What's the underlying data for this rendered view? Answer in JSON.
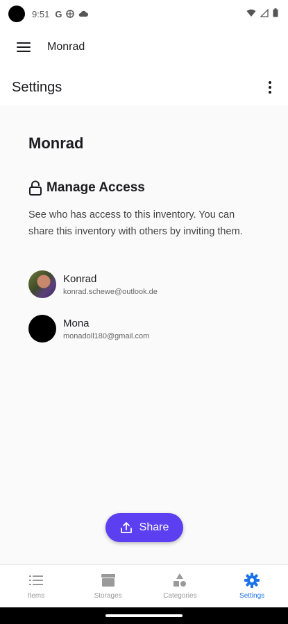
{
  "status_bar": {
    "time": "9:51",
    "icons": [
      "google-icon",
      "vpn-icon",
      "cloud-icon",
      "wifi-icon",
      "signal-icon",
      "battery-icon"
    ]
  },
  "app_bar": {
    "title": "Monrad"
  },
  "page_header": {
    "title": "Settings"
  },
  "inventory": {
    "name": "Monrad"
  },
  "manage_access": {
    "heading": "Manage Access",
    "description": "See who has access to this inventory. You can share this inventory with others by inviting them.",
    "members": [
      {
        "name": "Konrad",
        "email": "konrad.schewe@outlook.de",
        "avatar": "photo"
      },
      {
        "name": "Mona",
        "email": "monadoll180@gmail.com",
        "avatar": "black"
      }
    ]
  },
  "share_button": {
    "label": "Share"
  },
  "bottom_nav": {
    "items": [
      {
        "label": "Items",
        "icon": "list-icon"
      },
      {
        "label": "Storages",
        "icon": "storage-icon"
      },
      {
        "label": "Categories",
        "icon": "categories-icon"
      },
      {
        "label": "Settings",
        "icon": "gear-icon"
      }
    ],
    "active": "Settings"
  },
  "colors": {
    "accent": "#5b3ff0",
    "active_nav": "#1a73e8",
    "content_bg": "#fafafa"
  }
}
